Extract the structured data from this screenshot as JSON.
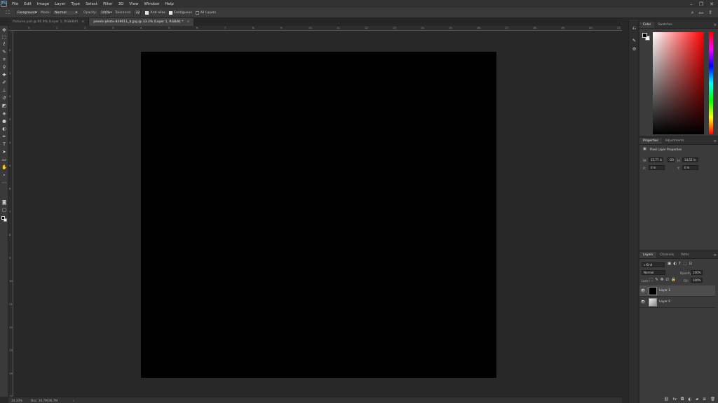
{
  "menu": {
    "logo": "Ps",
    "items": [
      "File",
      "Edit",
      "Image",
      "Layer",
      "Type",
      "Select",
      "Filter",
      "3D",
      "View",
      "Window",
      "Help"
    ]
  },
  "options": {
    "tool_icon": "paint-bucket-icon",
    "source": "Foreground",
    "mode_label": "Mode:",
    "mode": "Normal",
    "opacity_label": "Opacity:",
    "opacity": "100%",
    "tolerance_label": "Tolerance:",
    "tolerance": "32",
    "anti_alias": "Anti-alias",
    "contiguous": "Contiguous",
    "all_layers": "All Layers"
  },
  "tabs": [
    {
      "label": "Pictures.psd @ 90.9% (Layer 1, RGB/8#)",
      "close": "×"
    },
    {
      "label": "pexels-photo-839011_b.jpg @ 33.3% (Layer 1, RGB/8) *",
      "close": "×"
    }
  ],
  "ruler": {
    "top_ticks": [
      "0",
      "1",
      "2",
      "3",
      "4",
      "5",
      "6",
      "7",
      "8",
      "9",
      "10",
      "11",
      "12",
      "13",
      "14",
      "15",
      "16",
      "17",
      "18",
      "19",
      "20",
      "21"
    ],
    "left_ticks": [
      "0",
      "1",
      "2",
      "3",
      "4",
      "5",
      "6",
      "7",
      "8",
      "9",
      "10",
      "11",
      "12",
      "13",
      "14",
      "15"
    ]
  },
  "status": {
    "zoom": "33.33%",
    "doc": "Doc: 36,7M/36,7M"
  },
  "color_panel": {
    "tabs": [
      "Color",
      "Swatches"
    ],
    "foreground": "#000000",
    "background": "#ffffff",
    "hue": "#ff0000"
  },
  "properties_panel": {
    "tabs": [
      "Properties",
      "Adjustments"
    ],
    "title": "Pixel Layer Properties",
    "w_label": "W:",
    "w_value": "15,77 in",
    "go_label": "GO",
    "h_label": "H:",
    "h_value": "14,52 in",
    "x_label": "X:",
    "x_value": "0 in",
    "y_label": "Y:",
    "y_value": "0 in"
  },
  "layers_panel": {
    "tabs": [
      "Layers",
      "Channels",
      "Paths"
    ],
    "filter": "Kind",
    "blend_mode": "Normal",
    "opacity_label": "Opacity:",
    "opacity": "100%",
    "lock_label": "Lock:",
    "fill_label": "Fill:",
    "fill": "100%",
    "layers": [
      {
        "name": "Layer 1",
        "selected": true,
        "thumb": "#000000"
      },
      {
        "name": "Layer 0",
        "selected": false,
        "thumb": "#d9d9d9"
      }
    ]
  }
}
